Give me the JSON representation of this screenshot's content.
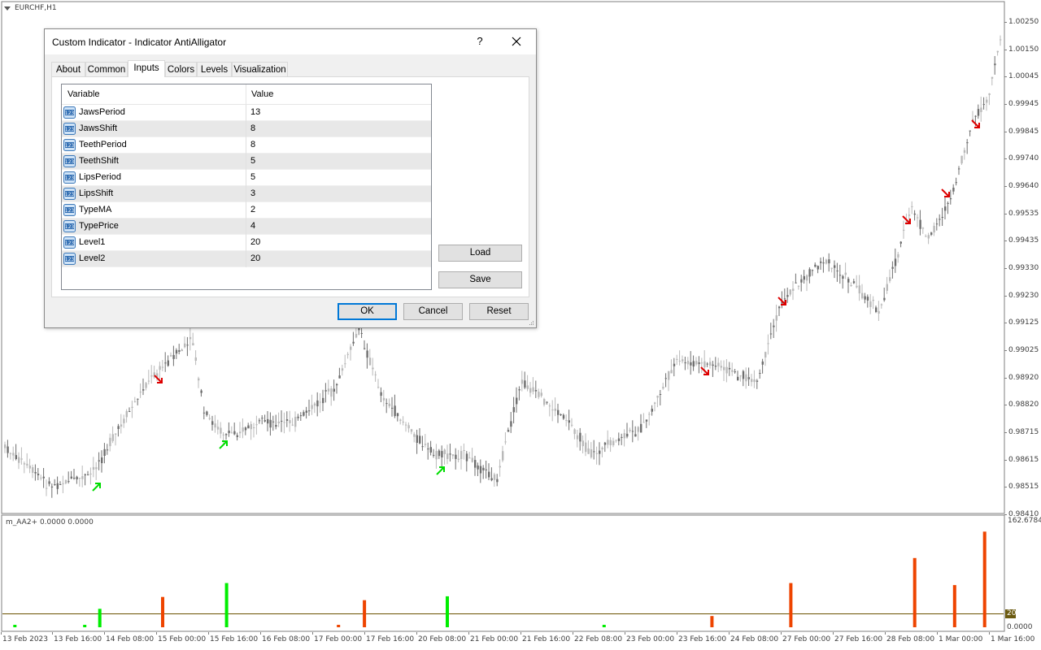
{
  "window": {
    "symbol": "EURCHF,H1",
    "subwindow_label": "m_AA2+ 0.0000 0.0000"
  },
  "price_axis": [
    "1.00250",
    "1.00150",
    "1.00045",
    "0.99945",
    "0.99845",
    "0.99740",
    "0.99640",
    "0.99535",
    "0.99435",
    "0.99330",
    "0.99230",
    "0.99125",
    "0.99025",
    "0.98920",
    "0.98820",
    "0.98715",
    "0.98615",
    "0.98515",
    "0.98410"
  ],
  "sub_axis": {
    "max": "162.6784",
    "level": "20",
    "min": "0.0000"
  },
  "time_axis": [
    "13 Feb 2023",
    "13 Feb 16:00",
    "14 Feb 08:00",
    "15 Feb 00:00",
    "15 Feb 16:00",
    "16 Feb 08:00",
    "17 Feb 00:00",
    "17 Feb 16:00",
    "20 Feb 08:00",
    "21 Feb 00:00",
    "21 Feb 16:00",
    "22 Feb 08:00",
    "23 Feb 00:00",
    "23 Feb 16:00",
    "24 Feb 08:00",
    "27 Feb 00:00",
    "27 Feb 16:00",
    "28 Feb 08:00",
    "1 Mar 00:00",
    "1 Mar 16:00"
  ],
  "chart_data": {
    "type": "bar",
    "series": [
      {
        "name": "m_AA2+",
        "color_up": "#00ee00",
        "color_down": "#ee4400"
      }
    ],
    "level": 20,
    "ylim": [
      0,
      162.6784
    ],
    "bars": [
      {
        "pos": 0.01,
        "value": 3,
        "dir": "up"
      },
      {
        "pos": 0.08,
        "value": 2,
        "dir": "up"
      },
      {
        "pos": 0.095,
        "value": 28,
        "dir": "up"
      },
      {
        "pos": 0.158,
        "value": 46,
        "dir": "down"
      },
      {
        "pos": 0.222,
        "value": 67,
        "dir": "up"
      },
      {
        "pos": 0.334,
        "value": 3,
        "dir": "down"
      },
      {
        "pos": 0.36,
        "value": 41,
        "dir": "down"
      },
      {
        "pos": 0.443,
        "value": 47,
        "dir": "up"
      },
      {
        "pos": 0.6,
        "value": 3,
        "dir": "up"
      },
      {
        "pos": 0.708,
        "value": 17,
        "dir": "down"
      },
      {
        "pos": 0.787,
        "value": 67,
        "dir": "down"
      },
      {
        "pos": 0.911,
        "value": 105,
        "dir": "down"
      },
      {
        "pos": 0.951,
        "value": 64,
        "dir": "down"
      },
      {
        "pos": 0.981,
        "value": 145,
        "dir": "down"
      }
    ]
  },
  "dialog": {
    "title": "Custom Indicator - Indicator AntiAlligator",
    "help": "?",
    "tabs": [
      "About",
      "Common",
      "Inputs",
      "Colors",
      "Levels",
      "Visualization"
    ],
    "active_tab": "Inputs",
    "grid": {
      "headers": [
        "Variable",
        "Value"
      ],
      "rows": [
        {
          "variable": "JawsPeriod",
          "value": "13"
        },
        {
          "variable": "JawsShift",
          "value": "8"
        },
        {
          "variable": "TeethPeriod",
          "value": "8"
        },
        {
          "variable": "TeethShift",
          "value": "5"
        },
        {
          "variable": "LipsPeriod",
          "value": "5"
        },
        {
          "variable": "LipsShift",
          "value": "3"
        },
        {
          "variable": "TypeMA",
          "value": "2"
        },
        {
          "variable": "TypePrice",
          "value": "4"
        },
        {
          "variable": "Level1",
          "value": "20"
        },
        {
          "variable": "Level2",
          "value": "20"
        }
      ]
    },
    "buttons": {
      "load": "Load",
      "save": "Save",
      "ok": "OK",
      "cancel": "Cancel",
      "reset": "Reset"
    }
  }
}
